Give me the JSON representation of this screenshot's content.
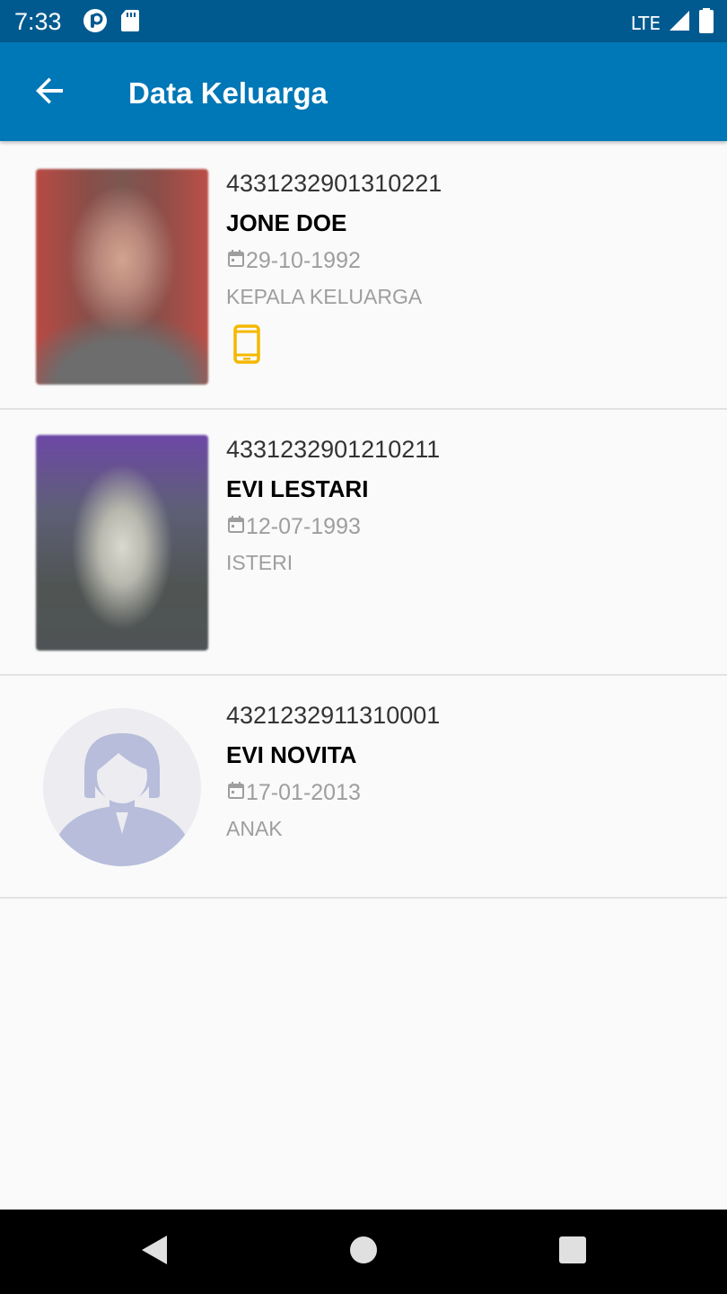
{
  "status_bar": {
    "time": "7:33",
    "network": "LTE",
    "icons": [
      "pinterest-like-app-icon",
      "sd-card-icon",
      "signal-icon",
      "battery-icon"
    ]
  },
  "app_bar": {
    "title": "Data Keluarga",
    "back_icon": "arrow-back-icon"
  },
  "members": [
    {
      "nik": "4331232901310221",
      "name": "JONE DOE",
      "dob": "29-10-1992",
      "relation": "KEPALA KELUARGA",
      "photo": "photo",
      "has_phone": true
    },
    {
      "nik": "4331232901210211",
      "name": "EVI LESTARI",
      "dob": "12-07-1993",
      "relation": "ISTERI",
      "photo": "photo",
      "has_phone": false
    },
    {
      "nik": "4321232911310001",
      "name": "EVI NOVITA",
      "dob": "17-01-2013",
      "relation": "ANAK",
      "photo": "default-avatar",
      "has_phone": false
    }
  ],
  "colors": {
    "status_bar": "#005a8f",
    "app_bar": "#0077b6",
    "background": "#fafafa",
    "secondary_text": "#9e9e9e",
    "phone_icon": "#f5b800",
    "avatar_fill": "#b7bdda",
    "avatar_bg": "#ececf1"
  },
  "nav_bar": {
    "icons": [
      "back-triangle-icon",
      "home-circle-icon",
      "recents-square-icon"
    ]
  }
}
